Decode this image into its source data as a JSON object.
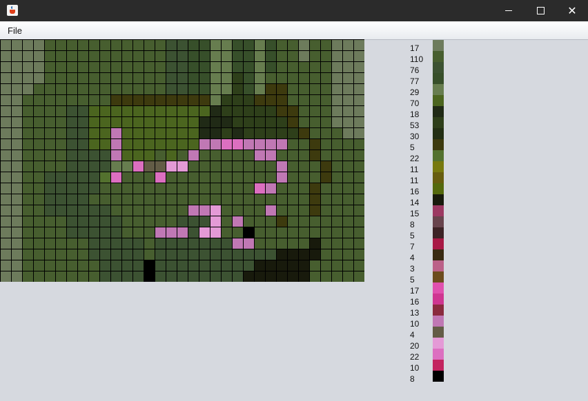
{
  "window": {
    "close_glyph": "✕"
  },
  "menu": {
    "file_label": "File"
  },
  "mosaic": {
    "palette": [
      "#6d7b5c",
      "#475e2f",
      "#3c5232",
      "#374f2a",
      "#677d4f",
      "#4b651f",
      "#202a16",
      "#2e3f1a",
      "#232f14",
      "#3d3a0e",
      "#53712e",
      "#77790e",
      "#675d0f",
      "#54690d",
      "#181a0c",
      "#9c3962",
      "#68444d",
      "#3d2326",
      "#a81945",
      "#392a12",
      "#bb6188",
      "#6c4c1d",
      "#e051ae",
      "#cf3691",
      "#8a2b3e",
      "#c078b4",
      "#635c46",
      "#e49ad6",
      "#dc6fc0",
      "#c3245f",
      "#000000"
    ],
    "rows": [
      "0000111111111112233443343110110",
      "0000111111111112233443343110110",
      "0000111111111112233443343111110",
      "0000111111111112233447341111110",
      "0001111111111112233447349911110",
      "0011111111999999999477799911110",
      "0011112255555555555677777991110",
      "0011112255555555556667777791110",
      "0011112255P555555566767777791110",
      "0011112255P5555555PPSSPPPP1191",
      "0011112222P555V5VPWXWWXPP11191",
      "001111222244SQQRRWWWXWWWXP11191",
      "001122222ASXXXSWWXXXXWXXWP11191",
      "001122222WWXXXWWWXWXWWXSP11191",
      "00112222WWXXXWWWXWWXWXWWX11191",
      "0011222222WXXWWWXPPRXXWXP11191",
      "00111122222WWXWX222RXP1119111",
      "00111122222VWWPPP2RRWWU1111111",
      "0011111122222W2222222PP11111E1",
      "0011111122222W22222222222EEEE1",
      "0011111112222U222222222EEEEE1",
      "0011111112222U22222222EEEEEE1"
    ]
  },
  "legend": {
    "items": [
      {
        "count": "17",
        "color": "#6d7b5c"
      },
      {
        "count": "110",
        "color": "#475e2f"
      },
      {
        "count": "76",
        "color": "#3c5232"
      },
      {
        "count": "77",
        "color": "#374f2a"
      },
      {
        "count": "29",
        "color": "#677d4f"
      },
      {
        "count": "70",
        "color": "#4b651f"
      },
      {
        "count": "18",
        "color": "#202a16"
      },
      {
        "count": "53",
        "color": "#2e3f1a"
      },
      {
        "count": "30",
        "color": "#232f14"
      },
      {
        "count": "5",
        "color": "#3d3a0e"
      },
      {
        "count": "22",
        "color": "#53712e"
      },
      {
        "count": "11",
        "color": "#77790e"
      },
      {
        "count": "11",
        "color": "#675d0f"
      },
      {
        "count": "16",
        "color": "#54690d"
      },
      {
        "count": "14",
        "color": "#181a0c"
      },
      {
        "count": "15",
        "color": "#9c3962"
      },
      {
        "count": "8",
        "color": "#68444d"
      },
      {
        "count": "5",
        "color": "#3d2326"
      },
      {
        "count": "7",
        "color": "#a81945"
      },
      {
        "count": "4",
        "color": "#392a12"
      },
      {
        "count": "3",
        "color": "#bb6188"
      },
      {
        "count": "5",
        "color": "#6c4c1d"
      },
      {
        "count": "17",
        "color": "#e051ae"
      },
      {
        "count": "16",
        "color": "#cf3691"
      },
      {
        "count": "13",
        "color": "#8a2b3e"
      },
      {
        "count": "10",
        "color": "#c078b4"
      },
      {
        "count": "4",
        "color": "#635c46"
      },
      {
        "count": "20",
        "color": "#e49ad6"
      },
      {
        "count": "22",
        "color": "#dc6fc0"
      },
      {
        "count": "10",
        "color": "#c3245f"
      },
      {
        "count": "8",
        "color": "#000000"
      }
    ]
  }
}
